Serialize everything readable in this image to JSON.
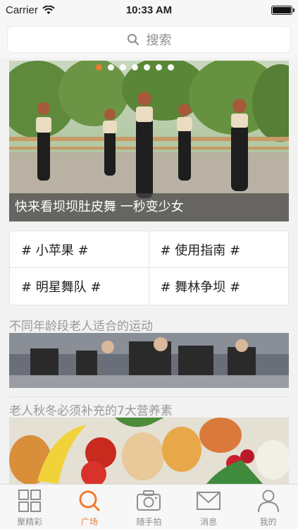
{
  "status": {
    "carrier": "Carrier",
    "time": "10:33 AM"
  },
  "search": {
    "placeholder": "搜索"
  },
  "banner": {
    "caption": "快来看坝坝肚皮舞 一秒变少女",
    "dot_count": 7,
    "active_dot": 0
  },
  "tags": [
    "# 小苹果 #",
    "# 使用指南 #",
    "# 明星舞队 #",
    "# 舞林争坝 #"
  ],
  "articles": [
    {
      "title": "不同年龄段老人适合的运动"
    },
    {
      "title": "老人秋冬必须补充的7大营养素"
    }
  ],
  "tabbar": {
    "items": [
      {
        "label": "聚精彩",
        "icon": "grid-icon"
      },
      {
        "label": "广场",
        "icon": "search-icon"
      },
      {
        "label": "随手拍",
        "icon": "camera-icon"
      },
      {
        "label": "消息",
        "icon": "mail-icon"
      },
      {
        "label": "我的",
        "icon": "user-icon"
      }
    ],
    "active_index": 1
  },
  "colors": {
    "accent": "#f07b2e",
    "inactive": "#8e8e93"
  }
}
